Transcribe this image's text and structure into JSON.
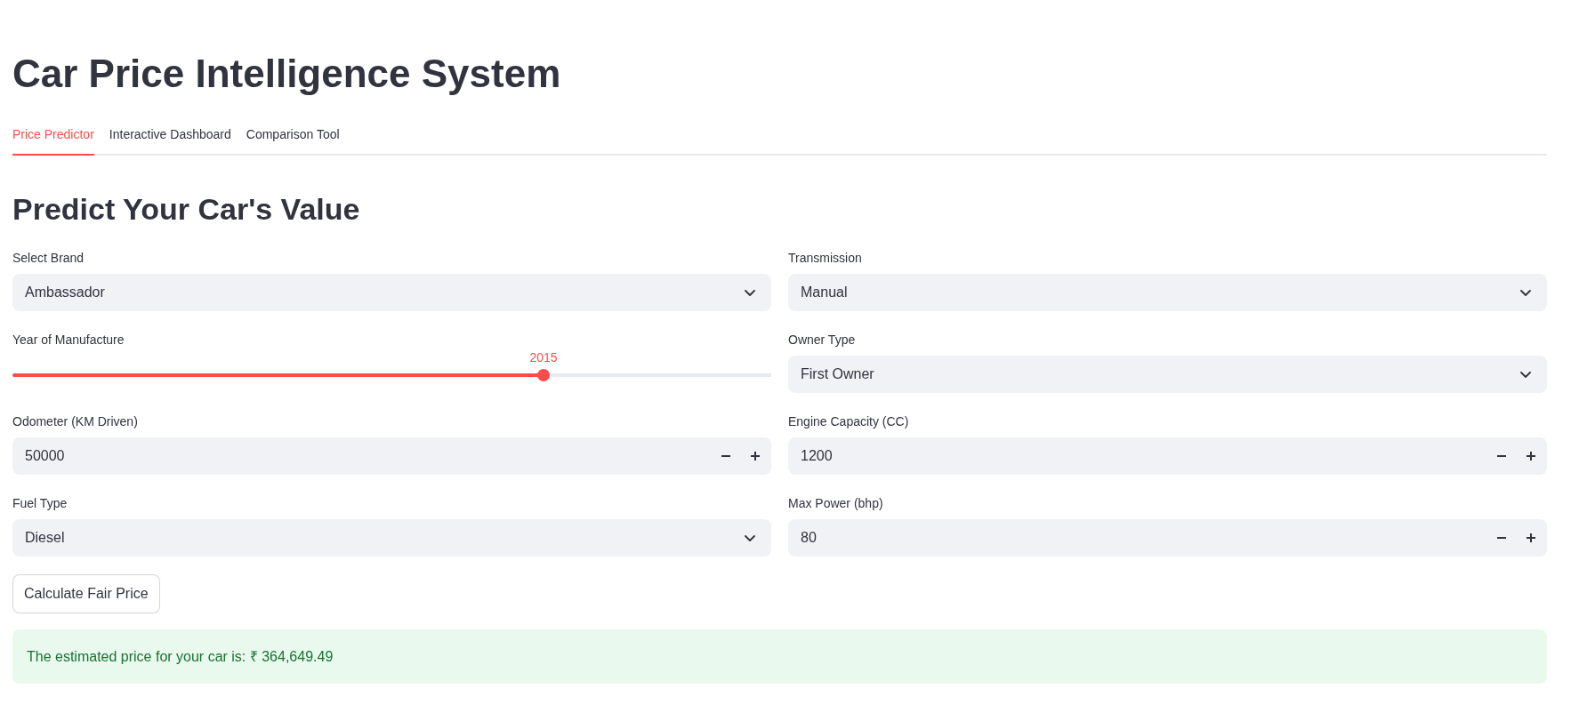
{
  "app": {
    "title": "Car Price Intelligence System"
  },
  "tabs": [
    {
      "label": "Price Predictor",
      "selected": true
    },
    {
      "label": "Interactive Dashboard",
      "selected": false
    },
    {
      "label": "Comparison Tool",
      "selected": false
    }
  ],
  "section": {
    "heading": "Predict Your Car's Value"
  },
  "form": {
    "columns": [
      {
        "fields": [
          {
            "kind": "select",
            "label": "Select Brand",
            "value": "Ambassador"
          },
          {
            "kind": "slider",
            "label": "Year of Manufacture",
            "value": "2015",
            "level": 0.7
          },
          {
            "kind": "number",
            "label": "Odometer (KM Driven)",
            "value": "50000"
          },
          {
            "kind": "select",
            "label": "Fuel Type",
            "value": "Diesel"
          }
        ]
      },
      {
        "fields": [
          {
            "kind": "select",
            "label": "Transmission",
            "value": "Manual"
          },
          {
            "kind": "select",
            "label": "Owner Type",
            "value": "First Owner"
          },
          {
            "kind": "number",
            "label": "Engine Capacity (CC)",
            "value": "1200"
          },
          {
            "kind": "number",
            "label": "Max Power (bhp)",
            "value": "80"
          }
        ]
      }
    ],
    "submit_button": {
      "label": "Calculate Fair Price"
    }
  },
  "result": {
    "message": "The estimated price for your car is: ₹ 364,649.49"
  }
}
